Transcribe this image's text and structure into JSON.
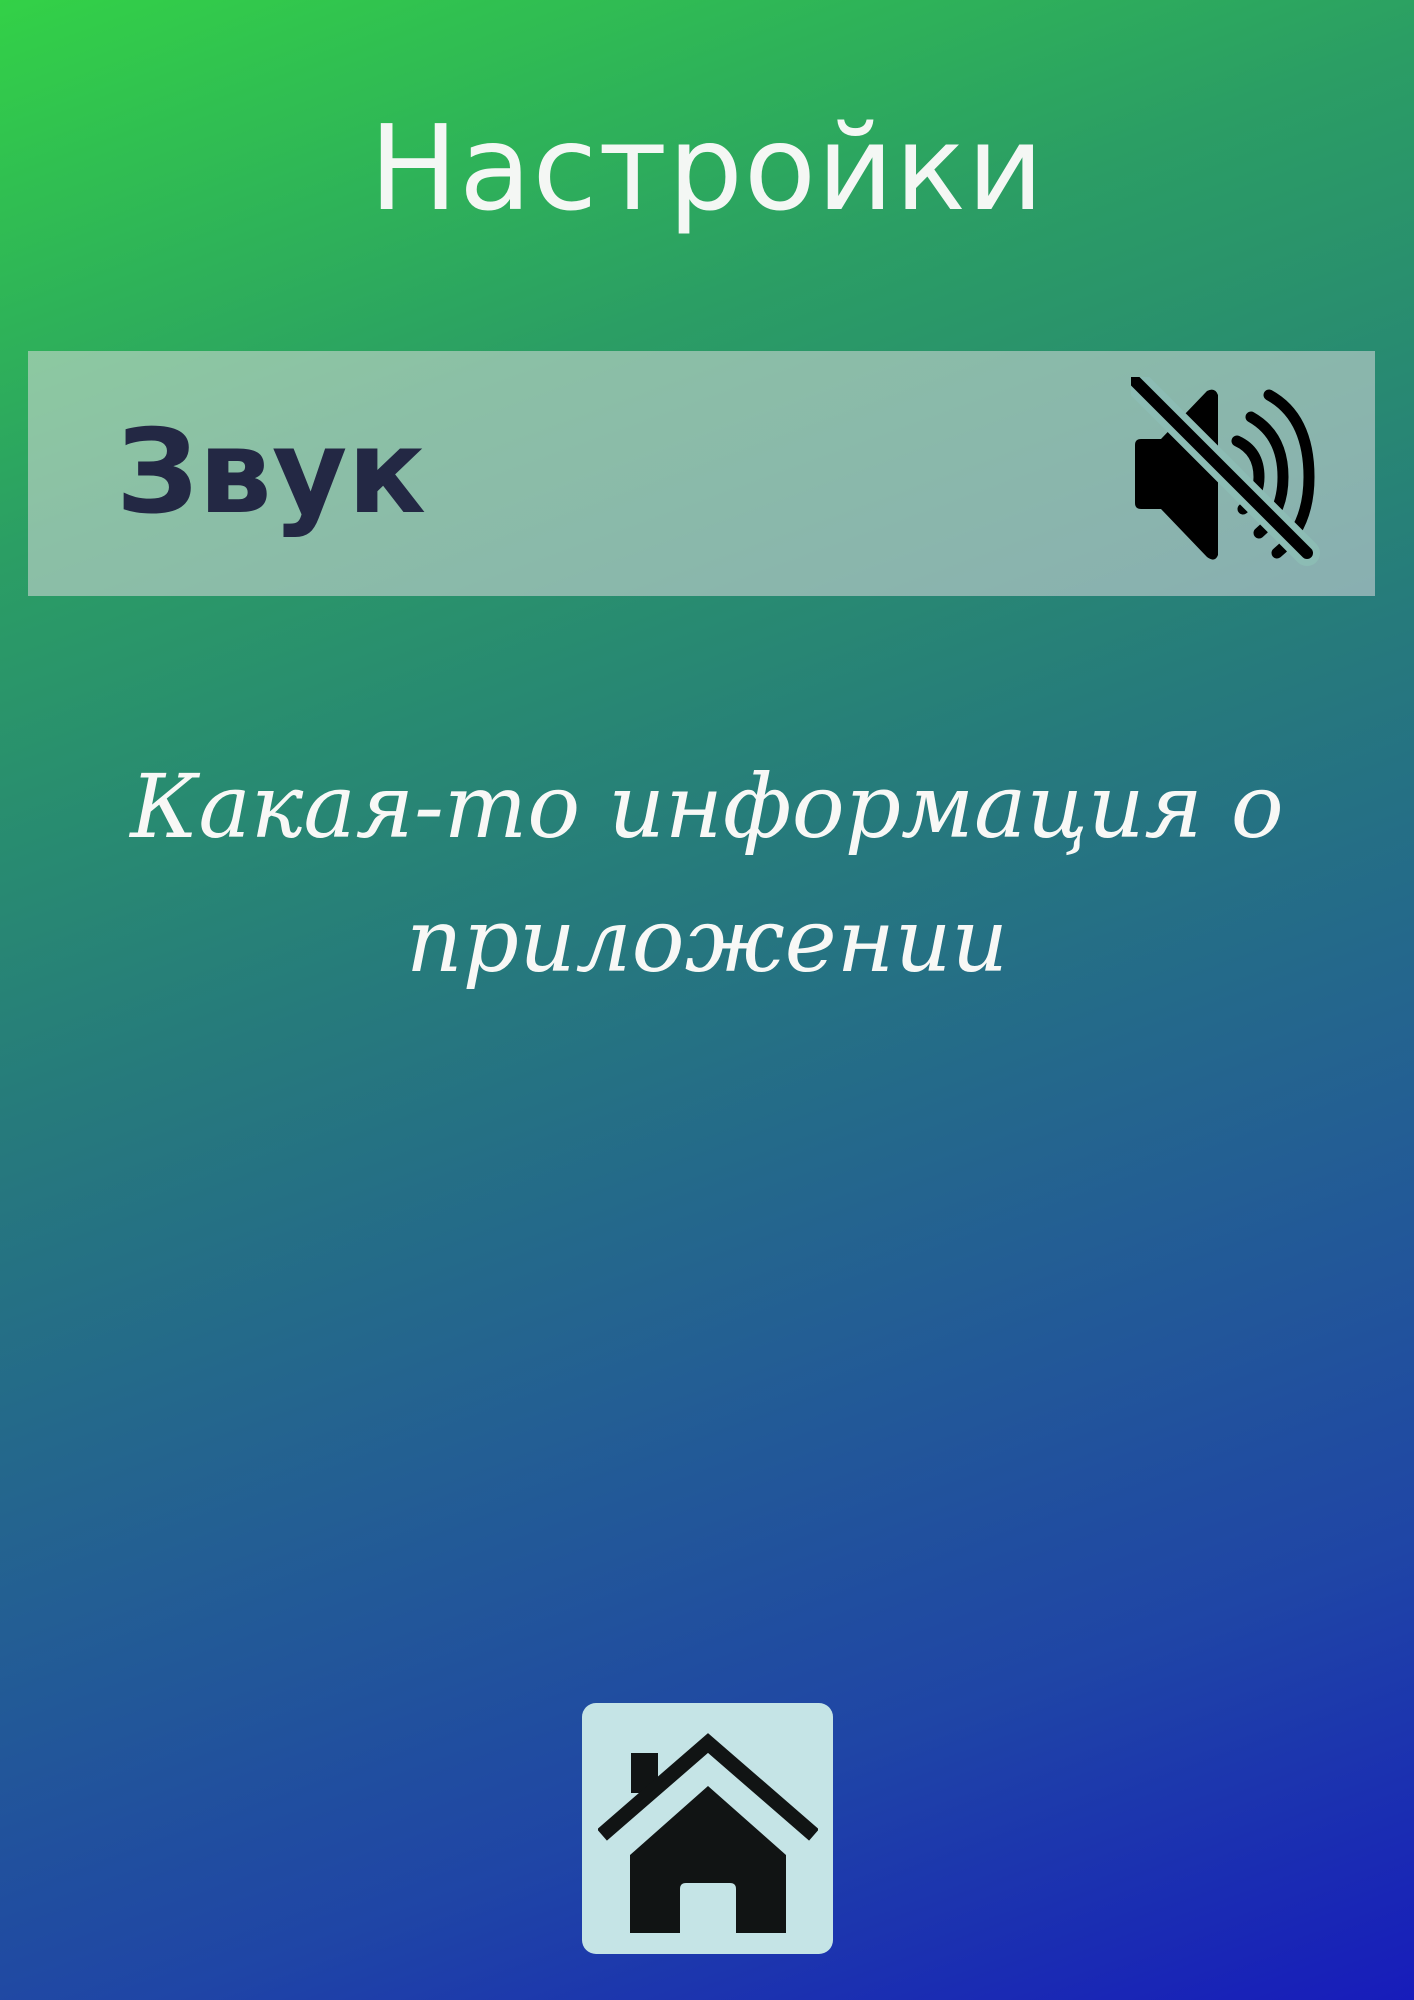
{
  "header": {
    "title": "Настройки"
  },
  "settings": {
    "sound": {
      "label": "Звук",
      "icon": "speaker-muted-icon",
      "muted": true
    }
  },
  "info": {
    "text": "Какая-то информация о приложении"
  },
  "nav": {
    "home_icon": "home-icon"
  },
  "colors": {
    "gradient_top": "#33d147",
    "gradient_bottom": "#171cbb",
    "row_background": "#c3c4cf",
    "label_text": "#232844",
    "home_button_background": "#c5e4e6",
    "icon": "#111414"
  }
}
